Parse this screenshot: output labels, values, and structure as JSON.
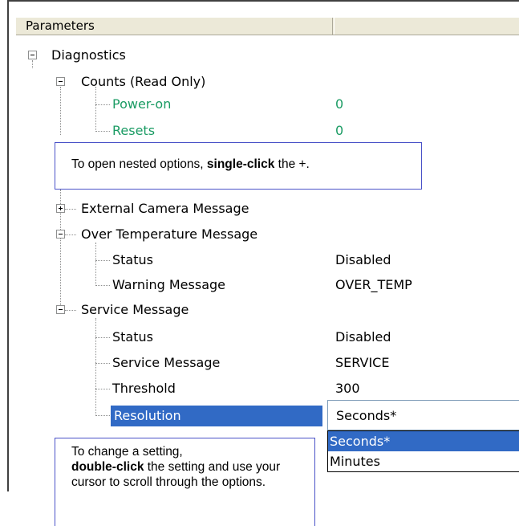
{
  "header": {
    "parameters_label": "Parameters",
    "value_label": ""
  },
  "tree": {
    "diagnostics": "Diagnostics",
    "counts": "Counts (Read Only)",
    "power_on": {
      "label": "Power-on",
      "value": "0"
    },
    "resets": {
      "label": "Resets",
      "value": "0"
    },
    "external_camera": "External Camera Message",
    "over_temp": "Over Temperature Message",
    "over_temp_status": {
      "label": "Status",
      "value": "Disabled"
    },
    "over_temp_warning": {
      "label": "Warning Message",
      "value": "OVER_TEMP"
    },
    "service": "Service Message",
    "service_status": {
      "label": "Status",
      "value": "Disabled"
    },
    "service_message": {
      "label": "Service Message",
      "value": "SERVICE"
    },
    "threshold": {
      "label": "Threshold",
      "value": "300"
    },
    "resolution": {
      "label": "Resolution",
      "value": "Seconds*"
    }
  },
  "dropdown": {
    "options": [
      "Seconds*",
      "Minutes"
    ],
    "selected": "Seconds*"
  },
  "callouts": {
    "open_nested_pre": "To open nested options, ",
    "open_nested_bold": "single-click",
    "open_nested_post": " the +.",
    "change_setting_pre": "To change a setting,",
    "change_setting_bold": "double-click",
    "change_setting_post": " the setting and use your cursor to scroll through the options."
  },
  "colors": {
    "selection": "#316ac5",
    "read_only_text": "#1a9b63",
    "callout_border": "#4a52c8"
  }
}
